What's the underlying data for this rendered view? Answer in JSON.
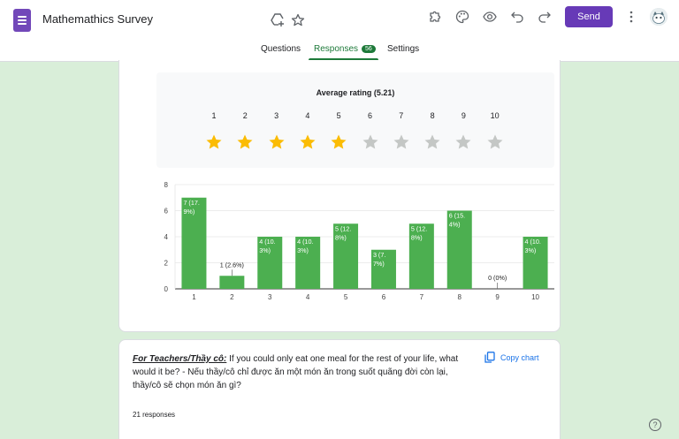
{
  "header": {
    "title": "Mathemathics Survey",
    "send_label": "Send",
    "icons": [
      "add-to-drive-icon",
      "star-icon",
      "addon-puzzle-icon",
      "palette-icon",
      "preview-eye-icon",
      "undo-icon",
      "redo-icon",
      "more-vert-icon"
    ]
  },
  "tabs": [
    {
      "label": "Questions"
    },
    {
      "label": "Responses",
      "badge": "56"
    },
    {
      "label": "Settings"
    }
  ],
  "rating": {
    "title": "Average rating (5.21)",
    "scale": [
      "1",
      "2",
      "3",
      "4",
      "5",
      "6",
      "7",
      "8",
      "9",
      "10"
    ],
    "filled_stars": 5,
    "star_color": "#fbbc04",
    "empty_star_color": "#c4c7c5"
  },
  "chart_data": {
    "type": "bar",
    "categories": [
      "1",
      "2",
      "3",
      "4",
      "5",
      "6",
      "7",
      "8",
      "9",
      "10"
    ],
    "values": [
      7,
      1,
      4,
      4,
      5,
      3,
      5,
      6,
      0,
      4
    ],
    "data_labels": [
      [
        "7 (17.",
        "9%)"
      ],
      [
        "1 (2.6%)"
      ],
      [
        "4 (10.",
        "3%)"
      ],
      [
        "4 (10.",
        "3%)"
      ],
      [
        "5 (12.",
        "8%)"
      ],
      [
        "3 (7.",
        "7%)"
      ],
      [
        "5 (12.",
        "8%)"
      ],
      [
        "6 (15.",
        "4%)"
      ],
      [
        "0 (0%)"
      ],
      [
        "4 (10.",
        "3%)"
      ]
    ],
    "y_ticks": [
      "0",
      "2",
      "4",
      "6",
      "8"
    ],
    "ylim": [
      0,
      8
    ],
    "color": "#4caf50",
    "grid": true
  },
  "question": {
    "bold_prefix": "For Teachers/Thầy cô:",
    "text": " If you could only eat one meal for the rest of your life, what would it be? - Nếu thầy/cô chỉ được ăn một món ăn trong suốt quãng đời còn lại, thầy/cô sẽ chọn món ăn gì?",
    "copy_label": "Copy chart",
    "responses": "21 responses"
  },
  "help_label": "?",
  "colors": {
    "accent": "#673ab7",
    "responses_green": "#1e7a3a",
    "background": "#d9eed9"
  }
}
